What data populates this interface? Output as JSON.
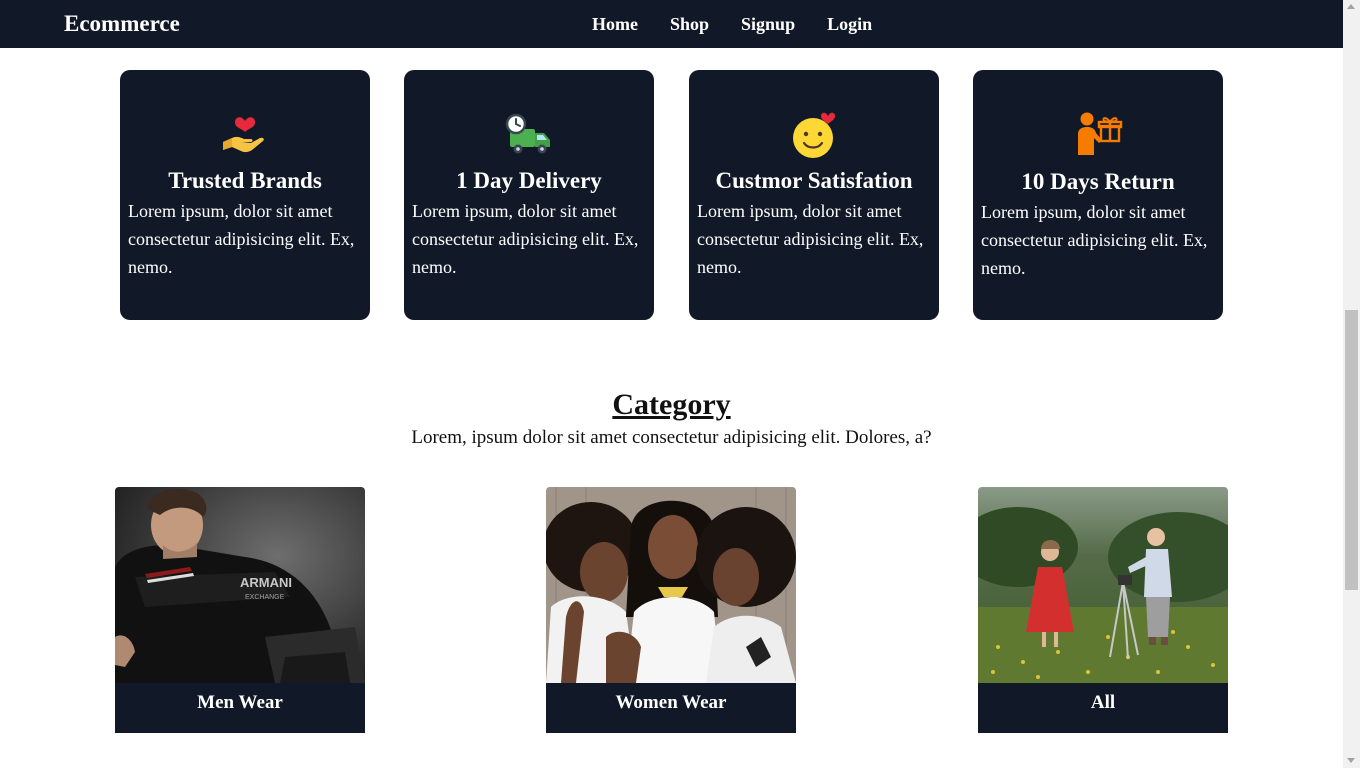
{
  "navbar": {
    "brand": "Ecommerce",
    "links": [
      "Home",
      "Shop",
      "Signup",
      "Login"
    ]
  },
  "features": [
    {
      "icon": "heart-hand-icon",
      "title": "Trusted Brands",
      "text": "Lorem ipsum, dolor sit amet consectetur adipisicing elit. Ex, nemo."
    },
    {
      "icon": "delivery-truck-icon",
      "title": "1 Day Delivery",
      "text": "Lorem ipsum, dolor sit amet consectetur adipisicing elit. Ex, nemo."
    },
    {
      "icon": "smiley-heart-icon",
      "title": "Custmor Satisfation",
      "text": "Lorem ipsum, dolor sit amet consectetur adipisicing elit. Ex, nemo."
    },
    {
      "icon": "person-gift-icon",
      "title": "10 Days Return",
      "text": "Lorem ipsum, dolor sit amet consectetur adipisicing elit. Ex, nemo."
    }
  ],
  "category": {
    "heading": "Category",
    "subtitle": "Lorem, ipsum dolor sit amet consectetur adipisicing elit. Dolores, a?",
    "items": [
      {
        "label": "Men Wear",
        "image": "man-leather-jacket-photo"
      },
      {
        "label": "Women Wear",
        "image": "three-women-photo"
      },
      {
        "label": "All",
        "image": "kids-in-field-photo"
      }
    ]
  },
  "colors": {
    "navy": "#111827",
    "white": "#ffffff"
  }
}
